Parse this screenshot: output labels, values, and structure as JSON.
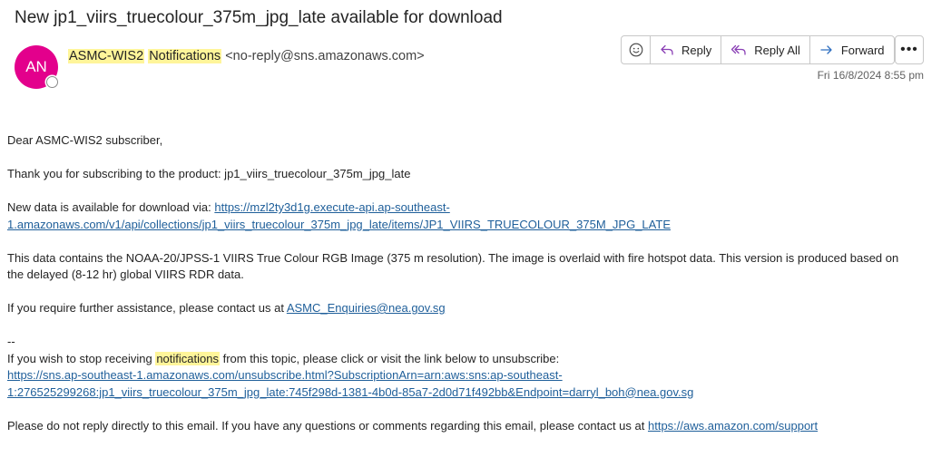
{
  "email": {
    "subject": "New jp1_viirs_truecolour_375m_jpg_late available for download",
    "avatar_initials": "AN",
    "avatar_color": "#e3008c",
    "sender_name_part1": "ASMC-WIS2",
    "sender_name_part2": "Notifications",
    "sender_address": "<no-reply@sns.amazonaws.com>",
    "date": "Fri 16/8/2024 8:55 pm"
  },
  "actions": {
    "reply_label": "Reply",
    "reply_all_label": "Reply All",
    "forward_label": "Forward",
    "more_label": "•••"
  },
  "body": {
    "greeting": "Dear ASMC-WIS2 subscriber,",
    "thanks": "Thank you for subscribing to the product: jp1_viirs_truecolour_375m_jpg_late",
    "new_data_prefix": "New data is available for download via: ",
    "new_data_link_line1": "https://mzl2ty3d1g.execute-api.ap-southeast-",
    "new_data_link_line2": "1.amazonaws.com/v1/api/collections/jp1_viirs_truecolour_375m_jpg_late/items/JP1_VIIRS_TRUECOLOUR_375M_JPG_LATE",
    "description_line1": "This data contains the NOAA-20/JPSS-1 VIIRS True Colour RGB Image (375 m resolution). The image is overlaid with fire hotspot data. This version is produced based on",
    "description_line2": "the delayed (8-12 hr) global VIIRS RDR data.",
    "assistance_prefix": "If you require further assistance, please contact us at ",
    "assistance_email": "ASMC_Enquiries@nea.gov.sg",
    "separator": "--",
    "unsubscribe_prefix": "If you wish to stop receiving ",
    "unsubscribe_highlight": "notifications",
    "unsubscribe_suffix": " from this topic, please click or visit the link below to unsubscribe:",
    "unsubscribe_link_line1": "https://sns.ap-southeast-1.amazonaws.com/unsubscribe.html?SubscriptionArn=arn:aws:sns:ap-southeast-",
    "unsubscribe_link_line2": "1:276525299268:jp1_viirs_truecolour_375m_jpg_late:745f298d-1381-4b0d-85a7-2d0d71f492bb&Endpoint=darryl_boh@nea.gov.sg",
    "footer_prefix": "Please do not reply directly to this email. If you have any questions or comments regarding this email, please contact us at ",
    "footer_link": "https://aws.amazon.com/support"
  }
}
